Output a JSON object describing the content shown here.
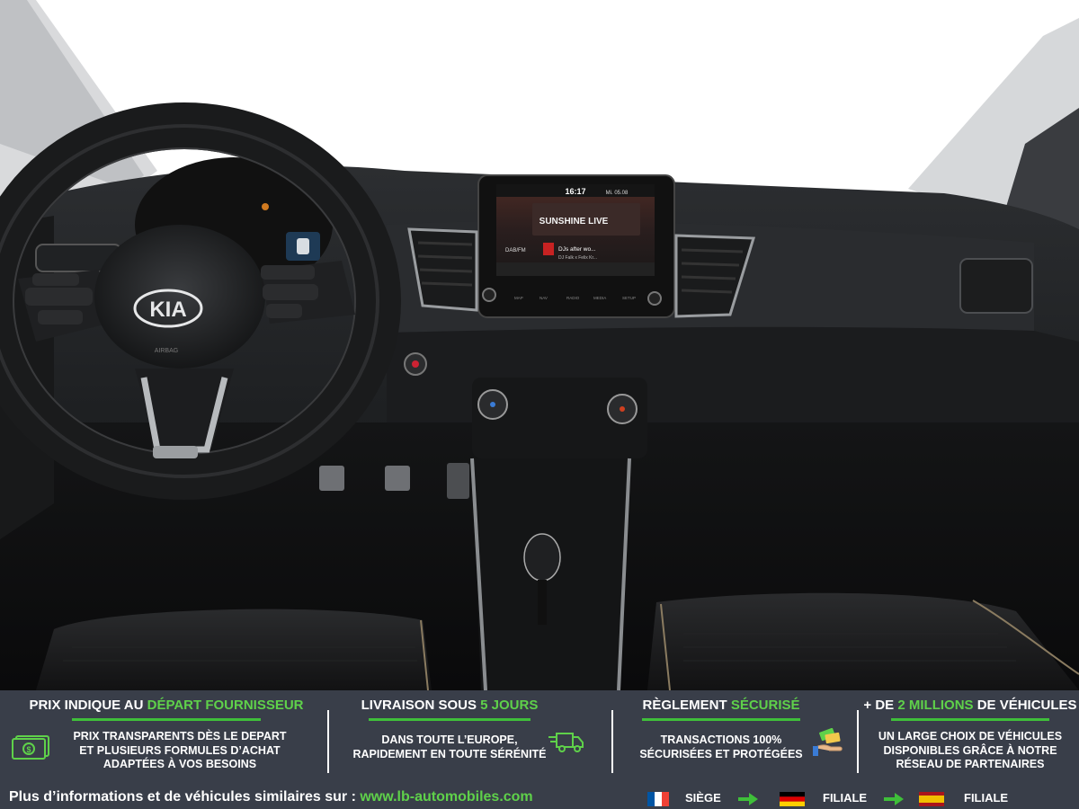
{
  "photo": {
    "brand_logo": "KIA",
    "airbag_label": "AIRBAG",
    "screen": {
      "clock": "16:17",
      "date": "Mi. 05.08",
      "station": "SUNSHINE LIVE",
      "band": "DAB/FM",
      "track": "DJs after wo...",
      "artist": "DJ Falk x Felix Kr...",
      "menu": [
        "MAP",
        "NAV",
        "RADIO",
        "MEDIA",
        "SETUP"
      ]
    }
  },
  "banner": {
    "columns": [
      {
        "title_main": "PRIX INDIQUE AU ",
        "title_hl": "DÉPART FOURNISSEUR",
        "body": "PRIX TRANSPARENTS DÈS LE DEPART\nET PLUSIEURS FORMULES D’ACHAT\nADAPTÉES À VOS BESOINS",
        "icon": "money-icon"
      },
      {
        "title_main": "LIVRAISON SOUS ",
        "title_hl": "5 JOURS",
        "body": "DANS TOUTE L’EUROPE,\nRAPIDEMENT EN TOUTE SÉRÉNITÉ",
        "icon": "delivery-truck-icon"
      },
      {
        "title_main": "RÈGLEMENT ",
        "title_hl": "SÉCURISÉ",
        "body": "TRANSACTIONS 100%\nSÉCURISÉES ET PROTÉGÉES",
        "icon": "payment-hand-icon"
      },
      {
        "title_pre": "+ DE ",
        "title_hl": "2 MILLIONS",
        "title_main": " DE VÉHICULES",
        "body": "UN LARGE CHOIX DE VÉHICULES\nDISPONIBLES GRÂCE À NOTRE\nRÉSEAU DE PARTENAIRES"
      }
    ],
    "footer": {
      "info_text": "Plus d’informations et de véhicules similaires sur : ",
      "url": "www.lb-automobiles.com",
      "locations": [
        {
          "label": "SIÈGE",
          "flag": "france-flag-icon"
        },
        {
          "label": "FILIALE",
          "flag": "germany-flag-icon"
        },
        {
          "label": "FILIALE",
          "flag": "spain-flag-icon"
        }
      ]
    },
    "colors": {
      "background": "#393e49",
      "accent": "#5fd14a"
    }
  }
}
